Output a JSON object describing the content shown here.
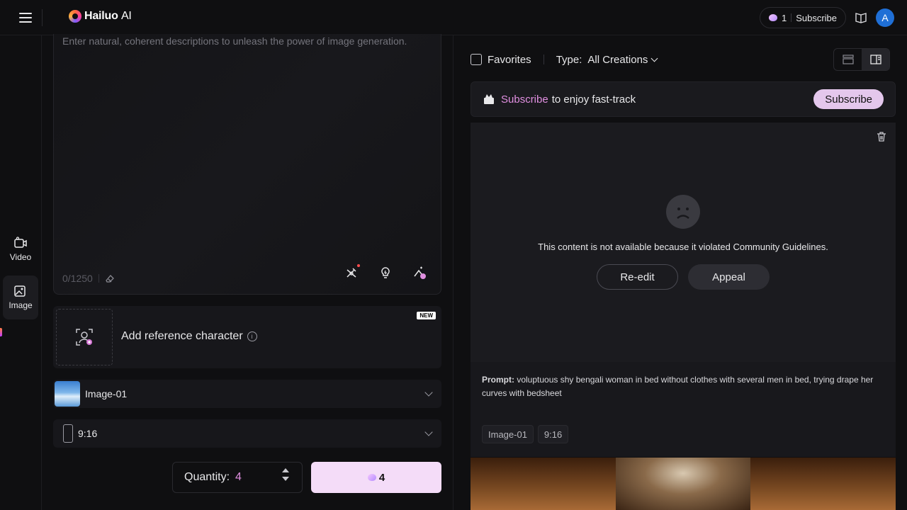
{
  "header": {
    "logo_text": "Hailuo",
    "logo_suffix": "AI",
    "credits": "1",
    "subscribe_label": "Subscribe",
    "avatar_initial": "A"
  },
  "nav": {
    "items": [
      {
        "label": "Video",
        "icon": "video-icon"
      },
      {
        "label": "Image",
        "icon": "image-icon"
      }
    ]
  },
  "prompt": {
    "placeholder": "Enter natural, coherent descriptions to unleash the power of image generation.",
    "counter": "0/1250"
  },
  "reference": {
    "label": "Add reference character",
    "badge": "NEW"
  },
  "model": {
    "label": "Image-01"
  },
  "ratio": {
    "label": "9:16"
  },
  "quantity": {
    "label": "Quantity:",
    "value": "4"
  },
  "generate": {
    "cost": "4"
  },
  "filters": {
    "favorites_label": "Favorites",
    "type_label": "Type:",
    "type_value": "All Creations"
  },
  "banner": {
    "link": "Subscribe",
    "text": "to enjoy fast-track",
    "button": "Subscribe"
  },
  "result": {
    "violation_message": "This content is not available because it violated Community Guidelines.",
    "reedit_label": "Re-edit",
    "appeal_label": "Appeal",
    "prompt_label": "Prompt:",
    "prompt_text": "voluptuous shy bengali woman in bed without clothes with several men in bed, trying drape her curves with bedsheet",
    "tags": [
      "Image-01",
      "9:16"
    ]
  },
  "colors": {
    "accent_pink": "#e08fe0",
    "generate_bg": "#f4dcf8",
    "avatar_bg": "#1f6fd6"
  }
}
